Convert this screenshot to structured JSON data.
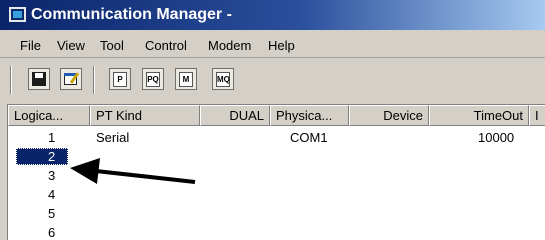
{
  "window": {
    "title": "Communication Manager -"
  },
  "menu": {
    "items": [
      "File",
      "View",
      "Tool",
      "Control",
      "Modem",
      "Help"
    ]
  },
  "toolbar": {
    "buttons": [
      {
        "icon": "save-icon"
      },
      {
        "icon": "properties-icon"
      },
      {
        "icon": "p-doc-icon",
        "glyph": "P"
      },
      {
        "icon": "pq-doc-icon",
        "glyph": "PQ"
      },
      {
        "icon": "m-doc-icon",
        "glyph": "M"
      },
      {
        "icon": "mq-doc-icon",
        "glyph": "MQ"
      }
    ]
  },
  "table": {
    "columns": [
      "Logica...",
      "PT Kind",
      "DUAL",
      "Physica...",
      "Device",
      "TimeOut",
      "I"
    ],
    "rows": [
      {
        "logical": "1",
        "pt_kind": "Serial",
        "dual": "",
        "physical": "COM1",
        "device": "",
        "timeout": "10000"
      },
      {
        "logical": "2",
        "pt_kind": "",
        "dual": "",
        "physical": "",
        "device": "",
        "timeout": ""
      },
      {
        "logical": "3",
        "pt_kind": "",
        "dual": "",
        "physical": "",
        "device": "",
        "timeout": ""
      },
      {
        "logical": "4",
        "pt_kind": "",
        "dual": "",
        "physical": "",
        "device": "",
        "timeout": ""
      },
      {
        "logical": "5",
        "pt_kind": "",
        "dual": "",
        "physical": "",
        "device": "",
        "timeout": ""
      },
      {
        "logical": "6",
        "pt_kind": "",
        "dual": "",
        "physical": "",
        "device": "",
        "timeout": ""
      }
    ],
    "selected_row": "2"
  },
  "colors": {
    "selection": "#0a246a",
    "title_bar": "#0a246a",
    "annotation_arrow": "#000000"
  }
}
